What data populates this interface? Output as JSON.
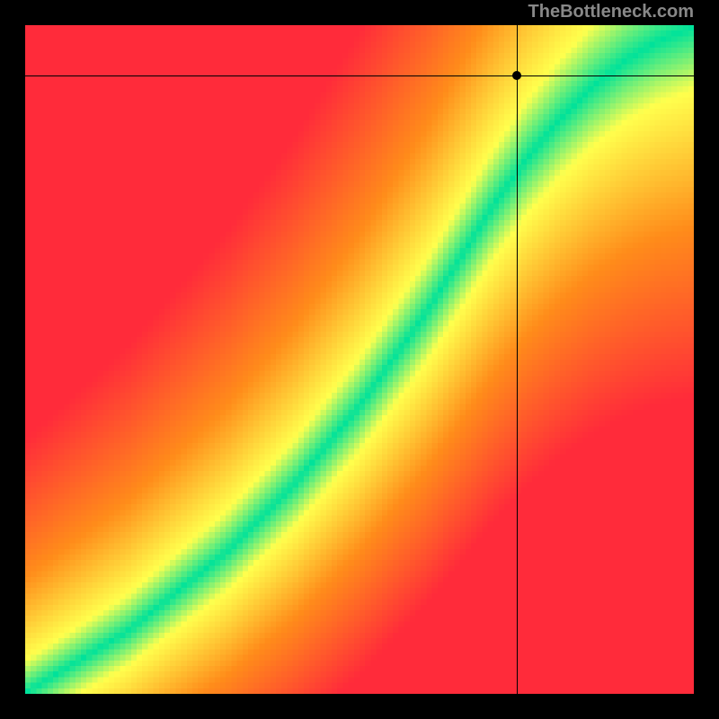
{
  "attribution": "TheBottleneck.com",
  "chart_data": {
    "type": "heatmap",
    "title": "",
    "xlabel": "",
    "ylabel": "",
    "xlim": [
      0,
      1
    ],
    "ylim": [
      0,
      1
    ],
    "crosshair": {
      "x": 0.735,
      "y": 0.925
    },
    "optimal_curve": [
      {
        "x": 0.0,
        "y": 0.0
      },
      {
        "x": 0.05,
        "y": 0.03
      },
      {
        "x": 0.1,
        "y": 0.06
      },
      {
        "x": 0.15,
        "y": 0.09
      },
      {
        "x": 0.2,
        "y": 0.13
      },
      {
        "x": 0.25,
        "y": 0.17
      },
      {
        "x": 0.3,
        "y": 0.21
      },
      {
        "x": 0.35,
        "y": 0.26
      },
      {
        "x": 0.4,
        "y": 0.31
      },
      {
        "x": 0.45,
        "y": 0.37
      },
      {
        "x": 0.5,
        "y": 0.43
      },
      {
        "x": 0.55,
        "y": 0.5
      },
      {
        "x": 0.6,
        "y": 0.57
      },
      {
        "x": 0.65,
        "y": 0.65
      },
      {
        "x": 0.7,
        "y": 0.73
      },
      {
        "x": 0.75,
        "y": 0.8
      },
      {
        "x": 0.8,
        "y": 0.86
      },
      {
        "x": 0.85,
        "y": 0.91
      },
      {
        "x": 0.9,
        "y": 0.95
      },
      {
        "x": 0.95,
        "y": 0.98
      },
      {
        "x": 1.0,
        "y": 1.0
      }
    ],
    "color_scale": [
      {
        "value": 0.0,
        "color": "#00e29a"
      },
      {
        "value": 0.15,
        "color": "#ffff4d"
      },
      {
        "value": 0.5,
        "color": "#ff8c1a"
      },
      {
        "value": 1.0,
        "color": "#ff2b3a"
      }
    ]
  }
}
